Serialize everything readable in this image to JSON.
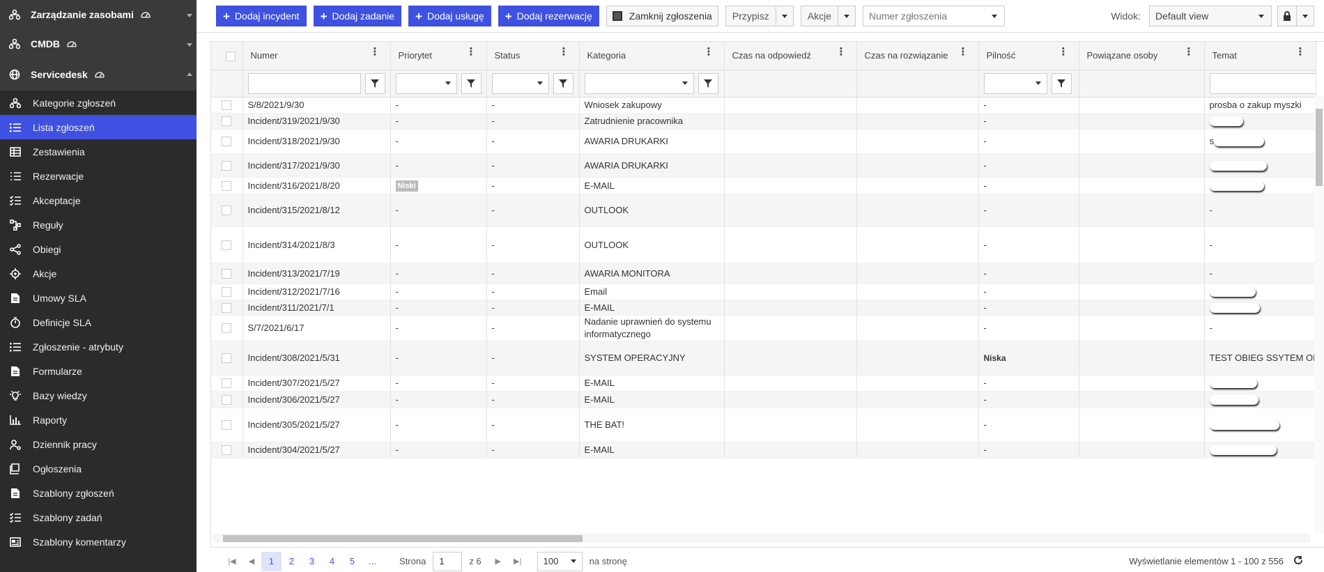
{
  "sidebar": {
    "sections": [
      {
        "label": "Zarządzanie zasobami",
        "icon": "network-icon",
        "expanded": false
      },
      {
        "label": "CMDB",
        "icon": "network-icon",
        "expanded": false
      },
      {
        "label": "Servicedesk",
        "icon": "globe-icon",
        "expanded": true
      }
    ],
    "items": [
      {
        "label": "Kategorie zgłoszeń",
        "icon": "categories-icon"
      },
      {
        "label": "Lista zgłoszeń",
        "icon": "list-icon",
        "active": true
      },
      {
        "label": "Zestawienia",
        "icon": "table-icon"
      },
      {
        "label": "Rezerwacje",
        "icon": "calendar-list-icon"
      },
      {
        "label": "Akceptacje",
        "icon": "checklist-icon"
      },
      {
        "label": "Reguły",
        "icon": "rules-icon"
      },
      {
        "label": "Obiegi",
        "icon": "workflow-icon"
      },
      {
        "label": "Akcje",
        "icon": "target-icon"
      },
      {
        "label": "Umowy SLA",
        "icon": "document-icon"
      },
      {
        "label": "Definicje SLA",
        "icon": "timer-icon"
      },
      {
        "label": "Zgłoszenie - atrybuty",
        "icon": "list-icon"
      },
      {
        "label": "Formularze",
        "icon": "document-icon"
      },
      {
        "label": "Bazy wiedzy",
        "icon": "lightbulb-icon"
      },
      {
        "label": "Raporty",
        "icon": "bar-chart-icon"
      },
      {
        "label": "Dziennik pracy",
        "icon": "user-settings-icon"
      },
      {
        "label": "Ogłoszenia",
        "icon": "announcement-icon"
      },
      {
        "label": "Szablony zgłoszeń",
        "icon": "document-icon"
      },
      {
        "label": "Szablony zadań",
        "icon": "checklist-icon"
      },
      {
        "label": "Szablony komentarzy",
        "icon": "comment-template-icon"
      }
    ]
  },
  "toolbar": {
    "add_incident": "Dodaj incydent",
    "add_task": "Dodaj zadanie",
    "add_service": "Dodaj usługę",
    "add_reservation": "Dodaj rezerwację",
    "close_tickets": "Zamknij zgłoszenia",
    "assign": "Przypisz",
    "actions": "Akcje",
    "ticket_number_placeholder": "Numer zgłoszenia",
    "view_label": "Widok:",
    "view_value": "Default view"
  },
  "grid": {
    "columns": [
      "Numer",
      "Priorytet",
      "Status",
      "Kategoria",
      "Czas na odpowiedź",
      "Czas na rozwiązanie",
      "Pilność",
      "Powiązane osoby",
      "Temat"
    ],
    "rows": [
      {
        "numer": "S/8/2021/9/30",
        "priorytet": "-",
        "status": "-",
        "kategoria": "Wniosek zakupowy",
        "pilnosc": "-",
        "temat": "prosba o zakup myszki",
        "h": 23
      },
      {
        "numer": "Incident/319/2021/9/30",
        "priorytet": "-",
        "status": "-",
        "kategoria": "Zatrudnienie pracownika",
        "pilnosc": "-",
        "temat": "",
        "blur": 48,
        "h": 23
      },
      {
        "numer": "Incident/318/2021/9/30",
        "priorytet": "-",
        "status": "-",
        "kategoria": "AWARIA DRUKARKI",
        "pilnosc": "-",
        "temat": "s",
        "blur": 72,
        "h": 35
      },
      {
        "numer": "Incident/317/2021/9/30",
        "priorytet": "-",
        "status": "-",
        "kategoria": "AWARIA DRUKARKI",
        "pilnosc": "-",
        "temat": "",
        "blur": 82,
        "h": 34
      },
      {
        "numer": "Incident/316/2021/8/20",
        "priorytet": "Niski",
        "status": "-",
        "kategoria": "E-MAIL",
        "pilnosc": "-",
        "temat": "",
        "blur": 78,
        "h": 24
      },
      {
        "numer": "Incident/315/2021/8/12",
        "priorytet": "-",
        "status": "-",
        "kategoria": "OUTLOOK",
        "pilnosc": "-",
        "temat": "-",
        "h": 47
      },
      {
        "numer": "Incident/314/2021/8/3",
        "priorytet": "-",
        "status": "-",
        "kategoria": "OUTLOOK",
        "pilnosc": "-",
        "temat": "-",
        "h": 52
      },
      {
        "numer": "Incident/313/2021/7/19",
        "priorytet": "-",
        "status": "-",
        "kategoria": "AWARIA MONITORA",
        "pilnosc": "-",
        "temat": "-",
        "h": 30
      },
      {
        "numer": "Incident/312/2021/7/16",
        "priorytet": "-",
        "status": "-",
        "kategoria": "Email",
        "pilnosc": "-",
        "temat": "",
        "blur": 66,
        "h": 23
      },
      {
        "numer": "Incident/311/2021/7/1",
        "priorytet": "-",
        "status": "-",
        "kategoria": "E-MAIL",
        "pilnosc": "-",
        "temat": "",
        "blur": 72,
        "h": 22
      },
      {
        "numer": "S/7/2021/6/17",
        "priorytet": "-",
        "status": "-",
        "kategoria": "Nadanie uprawnień do systemu informatycznego",
        "pilnosc": "-",
        "temat": "-",
        "h": 35,
        "wrap": true
      },
      {
        "numer": "Incident/308/2021/5/31",
        "priorytet": "-",
        "status": "-",
        "kategoria": "SYSTEM OPERACYJNY",
        "pilnosc": "Niska",
        "temat": "TEST OBIEG SSYTEM OPERACYJNY",
        "h": 49
      },
      {
        "numer": "Incident/307/2021/5/27",
        "priorytet": "-",
        "status": "-",
        "kategoria": "E-MAIL",
        "pilnosc": "-",
        "temat": "",
        "blur": 68,
        "h": 23
      },
      {
        "numer": "Incident/306/2021/5/27",
        "priorytet": "-",
        "status": "-",
        "kategoria": "E-MAIL",
        "pilnosc": "-",
        "temat": "",
        "blur": 70,
        "h": 24
      },
      {
        "numer": "Incident/305/2021/5/27",
        "priorytet": "-",
        "status": "-",
        "kategoria": "THE BAT!",
        "pilnosc": "-",
        "temat": "",
        "blur": 100,
        "h": 49
      },
      {
        "numer": "Incident/304/2021/5/27",
        "priorytet": "-",
        "status": "-",
        "kategoria": "E-MAIL",
        "pilnosc": "-",
        "temat": "",
        "blur": 96,
        "h": 23
      }
    ]
  },
  "pager": {
    "pages": [
      "1",
      "2",
      "3",
      "4",
      "5",
      "..."
    ],
    "page_label": "Strona",
    "current_page": "1",
    "of_label": "z 6",
    "page_size": "100",
    "per_page_label": "na stronę",
    "info": "Wyświetlanie elementów 1 - 100 z 556"
  },
  "colors": {
    "accent": "#3f51e0",
    "sidebar_bg": "#2b2b2b",
    "section_bg": "#3a3a3a"
  }
}
